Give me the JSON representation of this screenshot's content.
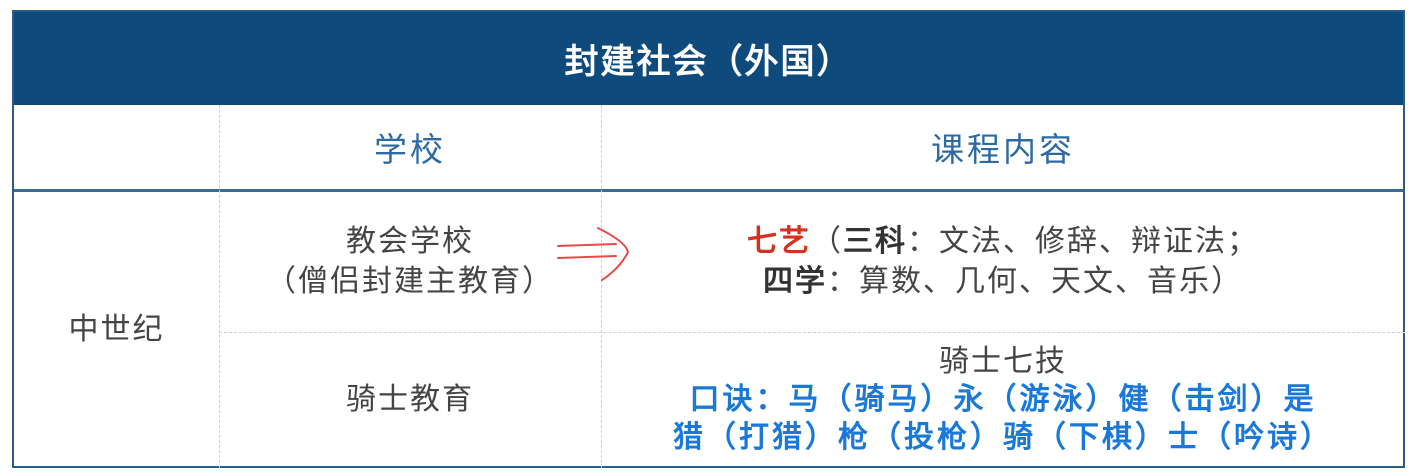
{
  "title": "封建社会（外国）",
  "headers": {
    "period": "",
    "school": "学校",
    "curriculum": "课程内容"
  },
  "period": "中世纪",
  "rows": [
    {
      "school_line1": "教会学校",
      "school_line2": "（僧侣封建主教育）",
      "content": {
        "seven_arts": "七艺",
        "open_paren": "（",
        "three_subjects": "三科",
        "three_list": "：文法、修辞、辩证法；",
        "four_subjects": "四学",
        "four_list": "：算数、几何、天文、音乐）"
      }
    },
    {
      "school_line1": "骑士教育",
      "content": {
        "heading": "骑士七技",
        "mnemonic_line1": "口诀：马（骑马）永（游泳）健（击剑）是",
        "mnemonic_line2": "猎（打猎）枪（投枪）骑（下棋）士（吟诗）"
      }
    }
  ],
  "colors": {
    "title_bg": "#0e4a7c",
    "header_text": "#2d6aa4",
    "highlight_red": "#d2321e",
    "mnemonic_blue": "#1a78d8",
    "annotation_arrow": "#e84a4a"
  },
  "annotation_icon": "hand-drawn-arrow-icon"
}
